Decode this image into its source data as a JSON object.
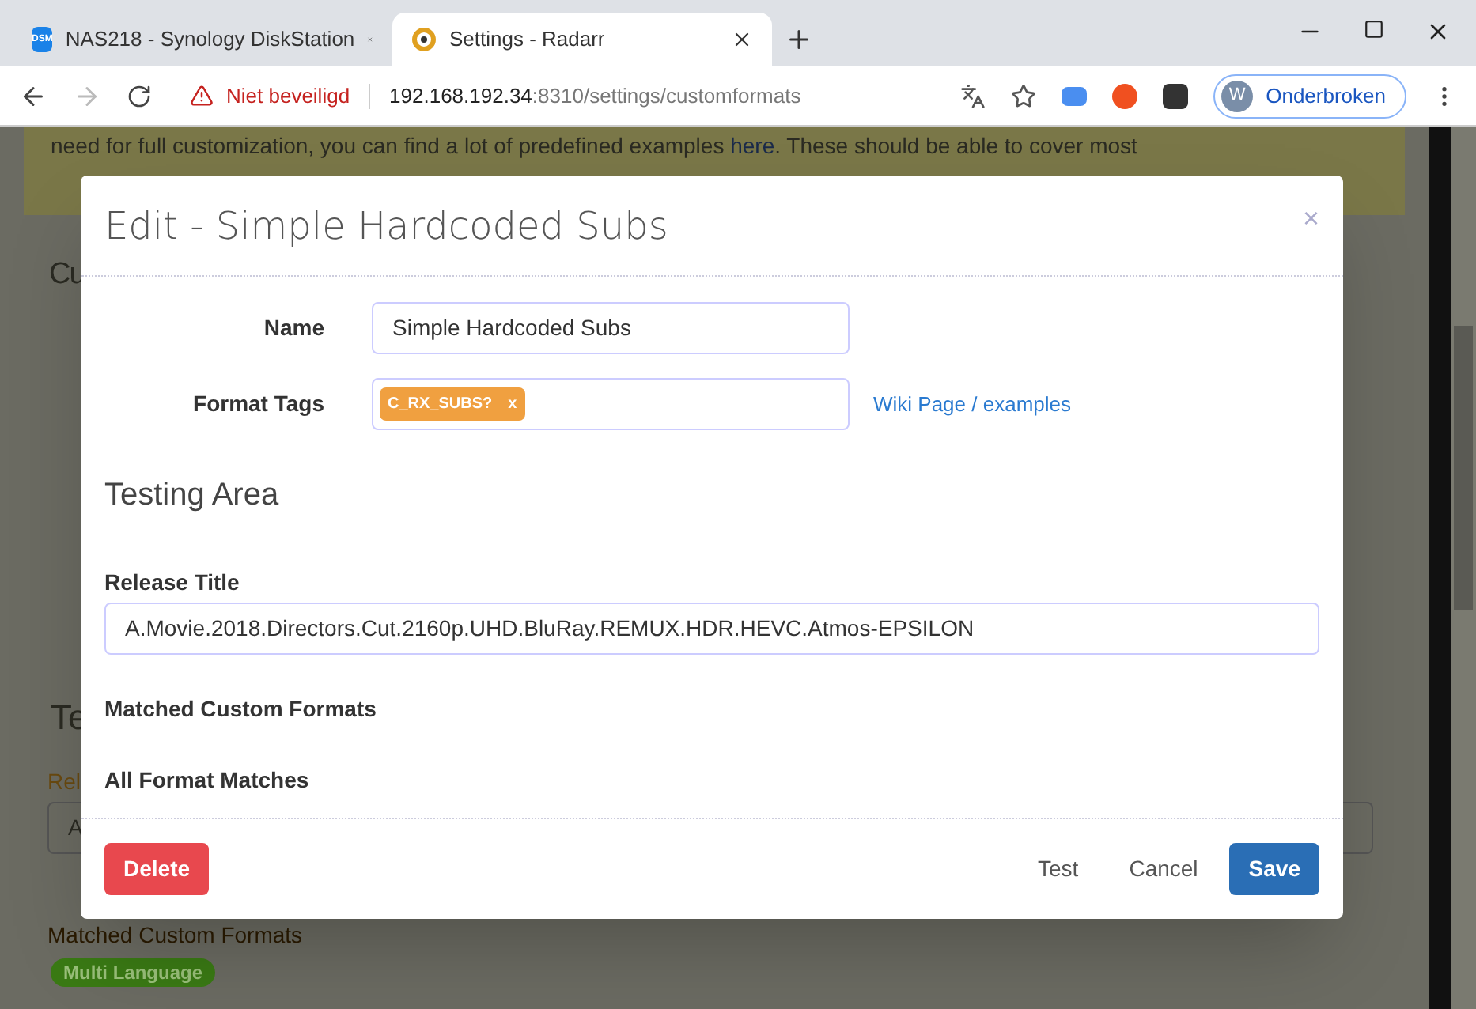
{
  "browser": {
    "tabs": [
      {
        "title": "NAS218 - Synology DiskStation",
        "icon": "DSM",
        "selected": false
      },
      {
        "title": "Settings - Radarr",
        "selected": true
      }
    ],
    "security": "Niet beveiligd",
    "url_host": "192.168.192.34",
    "url_rest": ":8310/settings/customformats",
    "profile_initial": "W",
    "profile_label": "Onderbroken"
  },
  "page": {
    "alert_text": "need for full customization, you can find a lot of predefined examples ",
    "alert_link": "here",
    "alert_rest": ". These should be able to cover most",
    "heading_1": "Cu",
    "heading_2": "Te",
    "label_1": "Rel",
    "input_value": "A",
    "label_2": "Matched Custom Formats",
    "tags": [
      {
        "label": "Multi Language",
        "color": "#3a7a14"
      }
    ]
  },
  "modal": {
    "title": "Edit - Simple Hardcoded Subs",
    "close": "×",
    "name_label": "Name",
    "name_value": "Simple Hardcoded Subs",
    "tags_label": "Format Tags",
    "tags": [
      {
        "label": "C_RX_SUBS?",
        "remove": "x"
      }
    ],
    "wiki_link": "Wiki Page / examples",
    "testing_heading": "Testing Area",
    "release_label": "Release Title",
    "release_value": "A.Movie.2018.Directors.Cut.2160p.UHD.BluRay.REMUX.HDR.HEVC.Atmos-EPSILON",
    "matched_label": "Matched Custom Formats",
    "all_label": "All Format Matches",
    "buttons": [
      {
        "label": "Delete",
        "kind": "danger"
      },
      {
        "label": "Test",
        "kind": "plain"
      },
      {
        "label": "Cancel",
        "kind": "plain"
      },
      {
        "label": "Save",
        "kind": "primary"
      }
    ]
  }
}
